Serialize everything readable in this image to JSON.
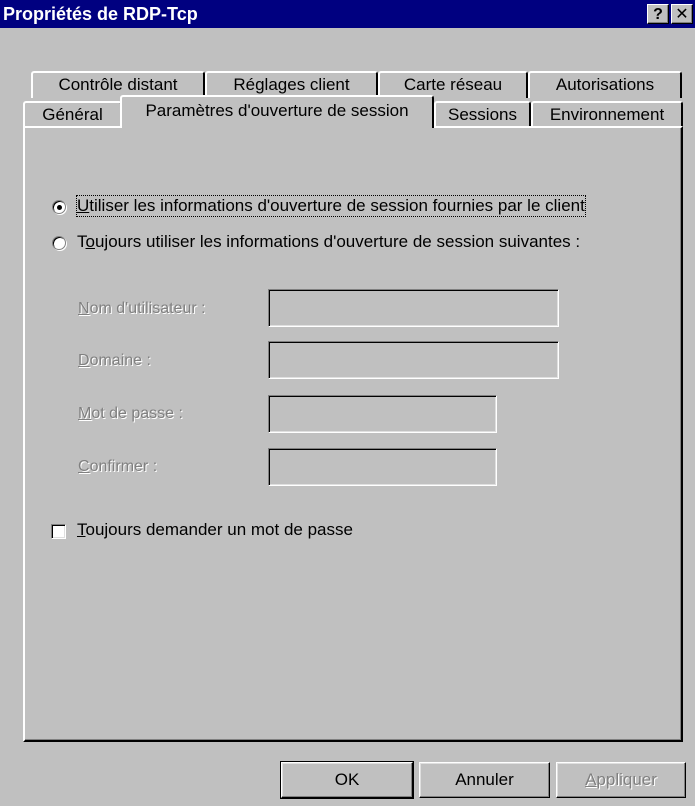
{
  "window": {
    "title": "Propriétés de RDP-Tcp",
    "help_label": "?",
    "close_label": "✕"
  },
  "tabs_row1": [
    {
      "label": "Contrôle distant"
    },
    {
      "label": "Réglages client"
    },
    {
      "label": "Carte réseau"
    },
    {
      "label": "Autorisations"
    }
  ],
  "tabs_row2": [
    {
      "label": "Général"
    },
    {
      "label": "Paramètres d'ouverture de session",
      "active": true
    },
    {
      "label": "Sessions"
    },
    {
      "label": "Environnement"
    }
  ],
  "logon": {
    "option_client": {
      "prefix": "U",
      "rest": "tiliser les informations d'ouverture de session fournies par le client",
      "selected": true
    },
    "option_always": {
      "pre": "T",
      "accel": "o",
      "rest": "ujours utiliser les informations d'ouverture de session suivantes :",
      "selected": false
    },
    "fields": {
      "username": {
        "accel": "N",
        "rest": "om d'utilisateur :",
        "value": ""
      },
      "domain": {
        "accel": "D",
        "rest": "omaine :",
        "value": ""
      },
      "password": {
        "accel": "M",
        "rest": "ot de passe :",
        "value": ""
      },
      "confirm": {
        "accel": "C",
        "rest": "onfirmer :",
        "value": ""
      }
    },
    "always_prompt": {
      "accel": "T",
      "rest": "oujours demander un mot de passe",
      "checked": false
    }
  },
  "buttons": {
    "ok": "OK",
    "cancel": "Annuler",
    "apply_accel": "A",
    "apply_rest": "ppliquer"
  }
}
